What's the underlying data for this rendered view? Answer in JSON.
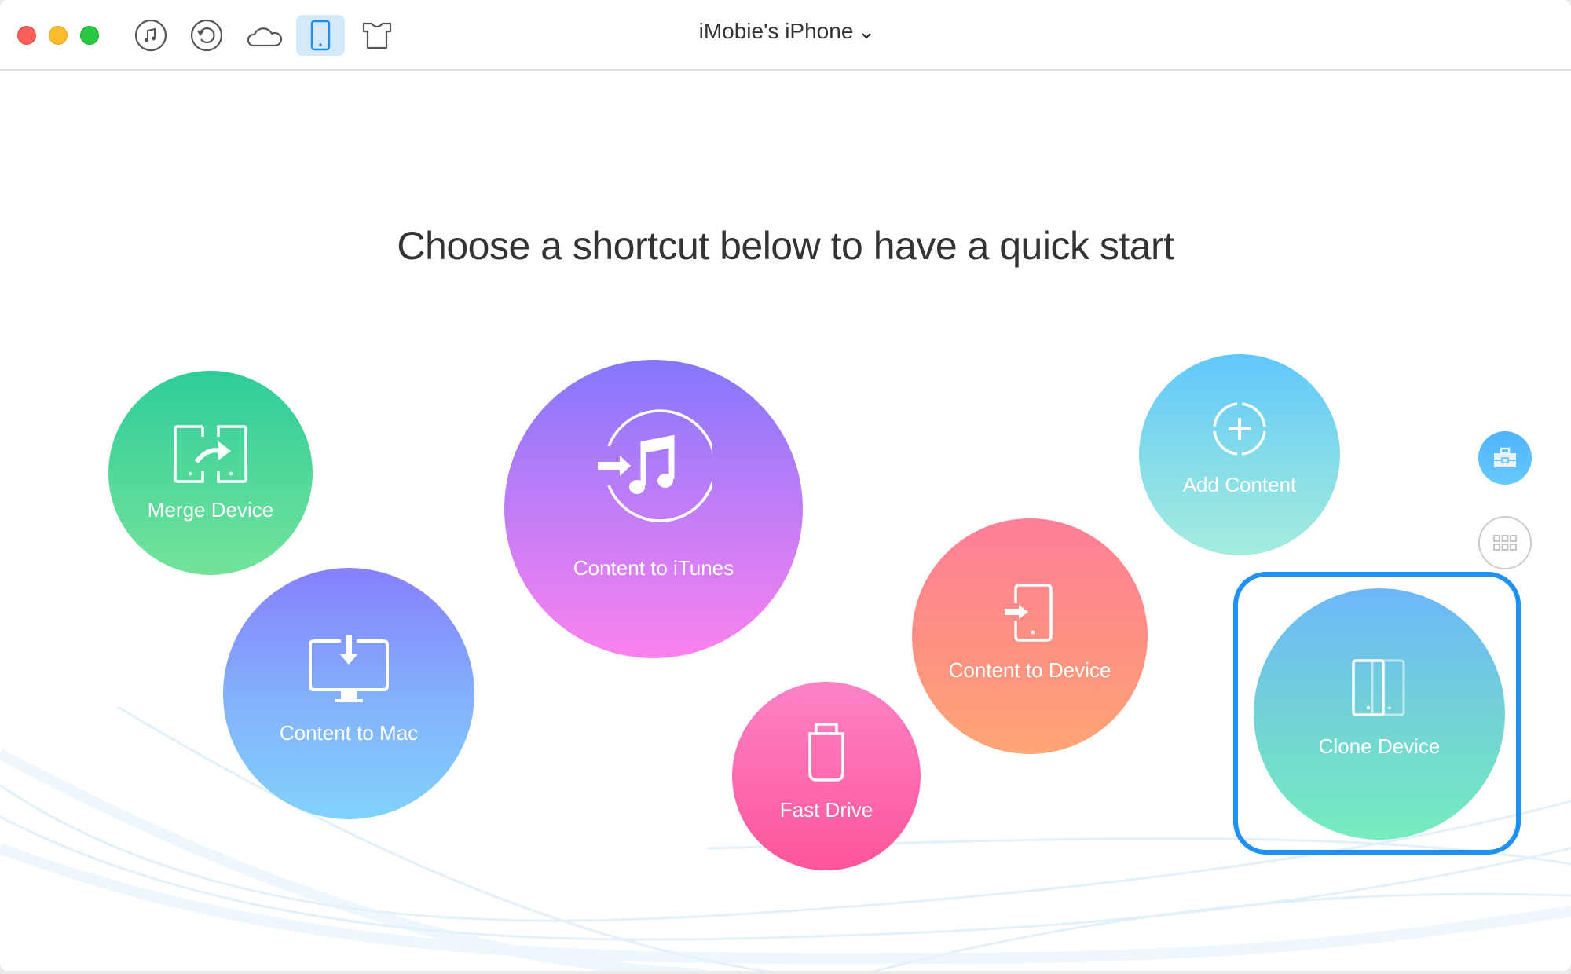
{
  "window": {
    "controls": [
      {
        "name": "close",
        "color": "#fc5f57"
      },
      {
        "name": "minimize",
        "color": "#fdbc2e"
      },
      {
        "name": "zoom",
        "color": "#28c840"
      }
    ]
  },
  "toolbar": {
    "tabs": [
      {
        "id": "itunes-library",
        "icon": "music-note-icon",
        "active": false
      },
      {
        "id": "backup-restore",
        "icon": "restore-icon",
        "active": false
      },
      {
        "id": "icloud",
        "icon": "cloud-icon",
        "active": false
      },
      {
        "id": "device",
        "icon": "phone-icon",
        "active": true
      },
      {
        "id": "toolkit",
        "icon": "tshirt-icon",
        "active": false
      }
    ],
    "device_name": "iMobie's iPhone",
    "accent_color": "#1e8fe8"
  },
  "main": {
    "headline": "Choose a shortcut below to have a quick start",
    "shortcuts": [
      {
        "id": "merge-device",
        "label": "Merge Device",
        "icon": "merge-device-icon"
      },
      {
        "id": "content-to-itunes",
        "label": "Content to iTunes",
        "icon": "itunes-transfer-icon"
      },
      {
        "id": "content-to-mac",
        "label": "Content to Mac",
        "icon": "mac-download-icon"
      },
      {
        "id": "fast-drive",
        "label": "Fast Drive",
        "icon": "usb-drive-icon"
      },
      {
        "id": "content-to-device",
        "label": "Content to Device",
        "icon": "device-import-icon"
      },
      {
        "id": "add-content",
        "label": "Add Content",
        "icon": "add-content-icon"
      },
      {
        "id": "clone-device",
        "label": "Clone Device",
        "icon": "clone-device-icon",
        "highlighted": true
      }
    ],
    "highlight_color": "#1f90f4"
  },
  "side_buttons": [
    {
      "id": "toolbox",
      "icon": "toolbox-icon",
      "active": true
    },
    {
      "id": "category-view",
      "icon": "grid-icon",
      "active": false
    }
  ]
}
